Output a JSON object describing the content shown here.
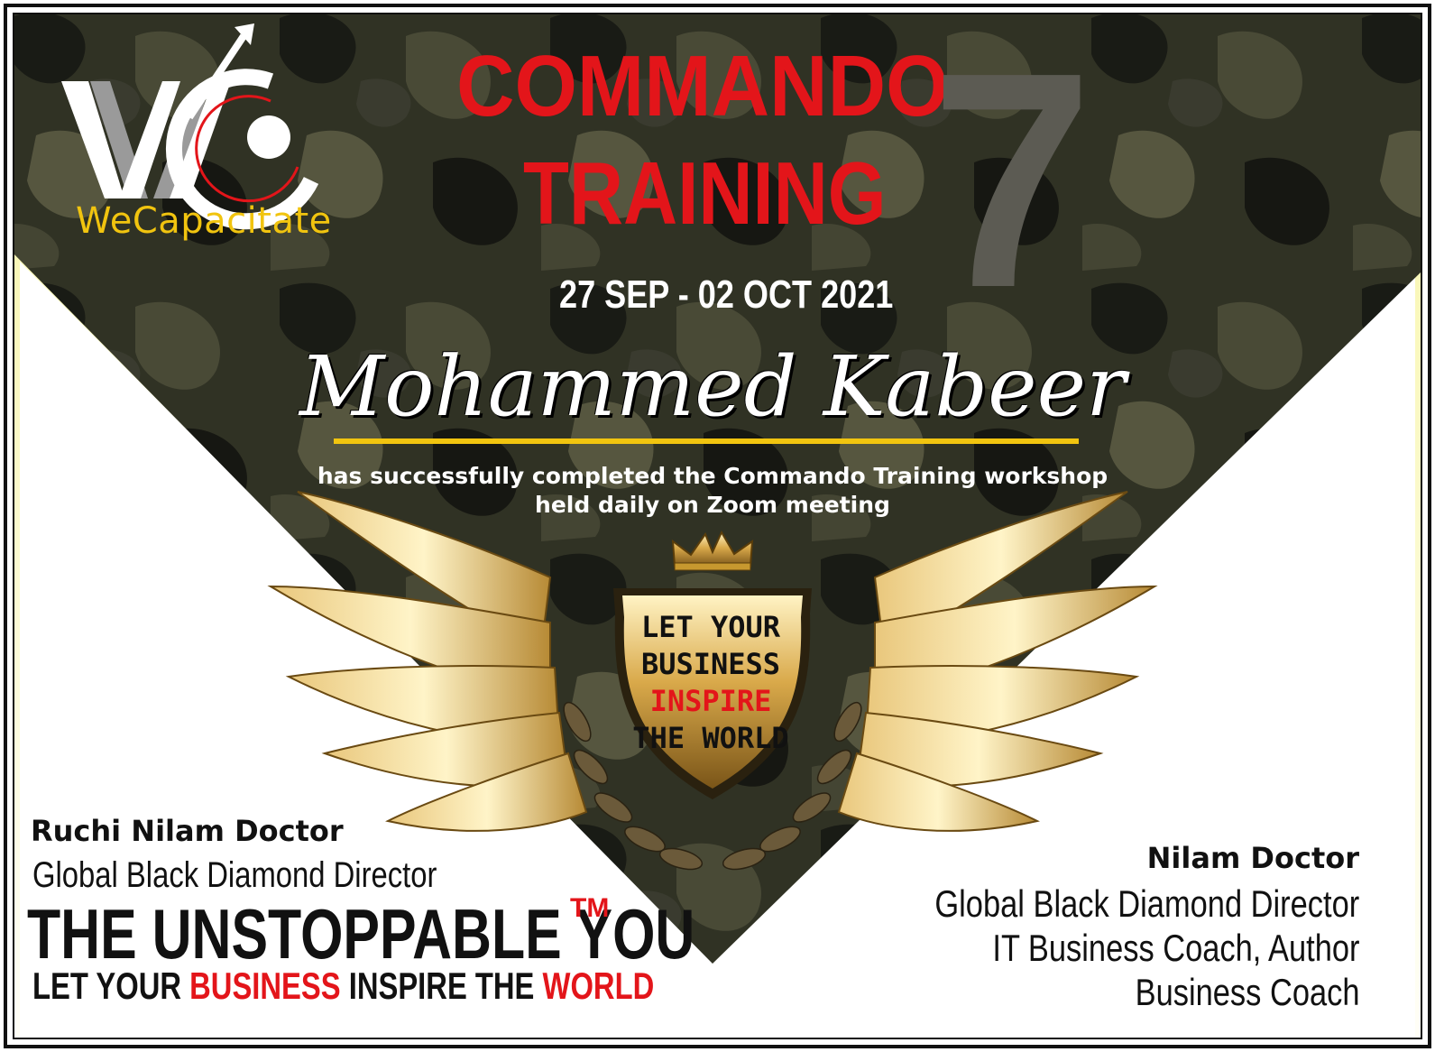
{
  "logo": {
    "initials": "WC",
    "name": "WeCapacitate"
  },
  "title": {
    "line1": "COMMANDO",
    "line2": "TRAINING",
    "number": "7"
  },
  "dates": "27 SEP - 02 OCT 2021",
  "recipient": {
    "name": "Mohammed Kabeer"
  },
  "description": {
    "line1": "has successfully completed the Commando Training workshop",
    "line2": "held daily on Zoom meeting"
  },
  "badge": {
    "line1": "LET YOUR",
    "line2": "BUSINESS",
    "line3": "INSPIRE",
    "line4": "THE WORLD"
  },
  "signatory_left": {
    "name": "Ruchi Nilam Doctor",
    "role": "Global Black Diamond Director"
  },
  "brand": {
    "name": "THE UNSTOPPABLE YOU",
    "trademark": "TM",
    "tagline": {
      "p1": "LET YOUR ",
      "p2": "BUSINESS",
      "p3": " INSPIRE THE ",
      "p4": "WORLD"
    }
  },
  "signatory_right": {
    "name": "Nilam Doctor",
    "role1": "Global Black Diamond Director",
    "role2": "IT Business Coach, Author",
    "role3": "Business Coach"
  },
  "colors": {
    "accent_red": "#e3151a",
    "gold": "#f1c40f",
    "camo_dark": "#2b2d22"
  }
}
